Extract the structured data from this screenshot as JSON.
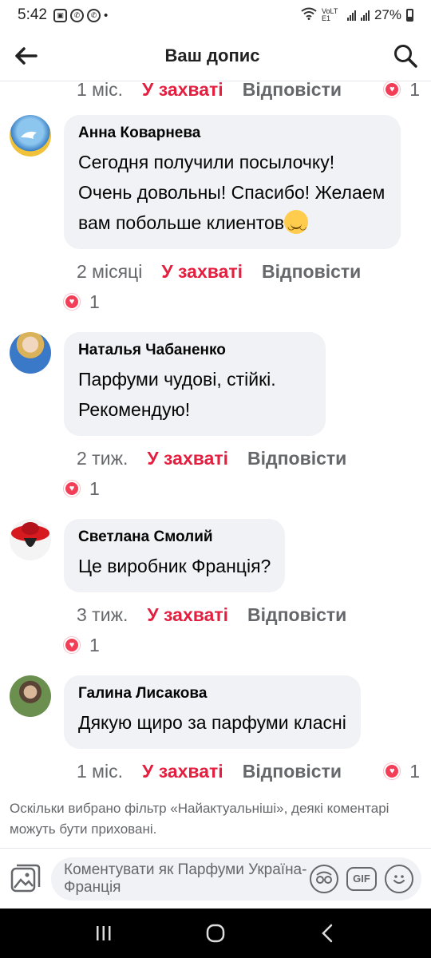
{
  "status_bar": {
    "time": "5:42",
    "battery": "27%",
    "network": "VoLTE1"
  },
  "header": {
    "title": "Ваш допис"
  },
  "top_actions": {
    "time": "1 міс.",
    "liked": "У захваті",
    "reply": "Відповісти",
    "reaction_count": "1"
  },
  "comments": [
    {
      "author": "Анна Коварнева",
      "text": "Сегодня получили посылочку! Очень довольны! Спасибо! Желаем вам побольше клиентов",
      "emoji": "smiling-face-icon",
      "time": "2 місяці",
      "liked": "У захваті",
      "reply": "Відповісти",
      "reaction_count": "1"
    },
    {
      "author": "Наталья Чабаненко",
      "text": "Парфуми чудові, стійкі. Рекомендую!",
      "time": "2 тиж.",
      "liked": "У захваті",
      "reply": "Відповісти",
      "reaction_count": "1"
    },
    {
      "author": "Светлана Смолий",
      "text": "Це виробник Франція?",
      "time": "3 тиж.",
      "liked": "У захваті",
      "reply": "Відповісти",
      "reaction_count": "1"
    },
    {
      "author": "Галина Лисакова",
      "text": "Дякую щиро за парфуми класні",
      "time": "1 міс.",
      "liked": "У захваті",
      "reply": "Відповісти",
      "reaction_count": "1"
    }
  ],
  "filter_note": "Оскільки вибрано фільтр «Найактуальніші», деякі коментарі можуть бути приховані.",
  "composer": {
    "placeholder": "Коментувати як Парфуми Україна-Франція",
    "gif_label": "GIF"
  },
  "colors": {
    "liked": "#e41e3f",
    "bubble": "#f0f2f5",
    "secondary_text": "#65676b",
    "heart": "#f33e58"
  }
}
